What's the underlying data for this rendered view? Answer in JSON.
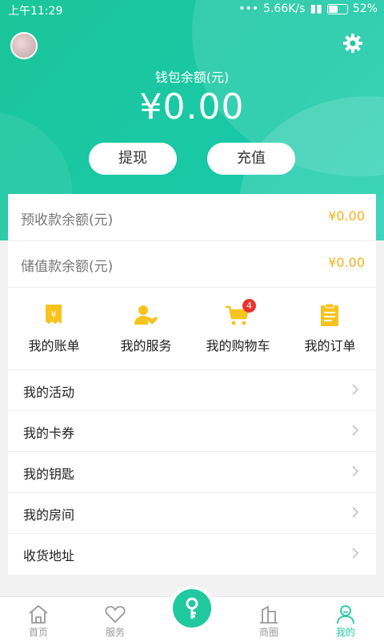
{
  "status_bar": {
    "time": "上午11:29",
    "speed": "5.66K/s",
    "battery": "52%"
  },
  "header": {
    "wallet_label": "钱包余额(元)",
    "wallet_amount": "¥0.00",
    "withdraw_label": "提现",
    "recharge_label": "充值"
  },
  "balances": [
    {
      "label": "预收款余额(元)",
      "value": "¥0.00"
    },
    {
      "label": "储值款余额(元)",
      "value": "¥0.00"
    }
  ],
  "shortcuts": [
    {
      "label": "我的账单",
      "icon": "bill-icon"
    },
    {
      "label": "我的服务",
      "icon": "service-icon"
    },
    {
      "label": "我的购物车",
      "icon": "cart-icon",
      "badge": "4"
    },
    {
      "label": "我的订单",
      "icon": "order-icon"
    }
  ],
  "menu": [
    {
      "label": "我的活动"
    },
    {
      "label": "我的卡券"
    },
    {
      "label": "我的钥匙"
    },
    {
      "label": "我的房间"
    },
    {
      "label": "收货地址"
    }
  ],
  "tabbar": [
    {
      "label": "首页",
      "icon": "home-icon"
    },
    {
      "label": "服务",
      "icon": "heart-icon"
    },
    {
      "label": "",
      "icon": "key-icon"
    },
    {
      "label": "商圈",
      "icon": "buildings-icon"
    },
    {
      "label": "我的",
      "icon": "profile-icon",
      "active": true
    }
  ],
  "colors": {
    "accent": "#20c9a0",
    "amount": "#f5b21b",
    "icon_yellow": "#f7c31d",
    "badge": "#e8332c"
  }
}
